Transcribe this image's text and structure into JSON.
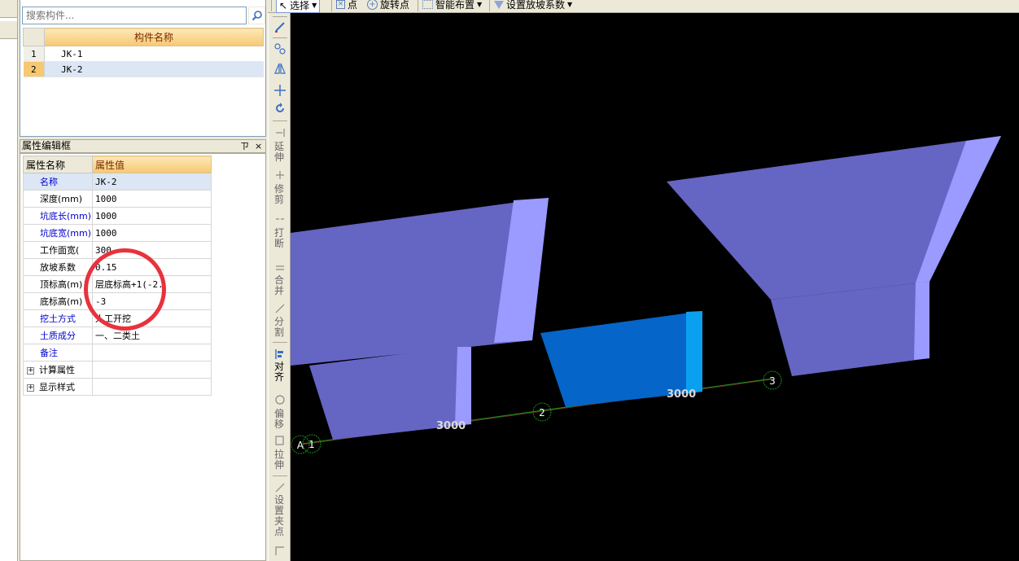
{
  "search": {
    "placeholder": "搜索构件..."
  },
  "component_list": {
    "header": "构件名称",
    "rows": [
      {
        "num": "1",
        "name": "JK-1"
      },
      {
        "num": "2",
        "name": "JK-2"
      }
    ]
  },
  "property_panel": {
    "title": "属性编辑框",
    "pin_label": "ㄗ",
    "close_label": "×",
    "col_name": "属性名称",
    "col_value": "属性值",
    "rows": [
      {
        "key": "名称",
        "value": "JK-2"
      },
      {
        "key": "深度(mm)",
        "value": "1000"
      },
      {
        "key": "坑底长(mm)",
        "value": "1000"
      },
      {
        "key": "坑底宽(mm)",
        "value": "1000"
      },
      {
        "key": "工作面宽(",
        "value": "300"
      },
      {
        "key": "放坡系数",
        "value": "0.15"
      },
      {
        "key": "顶标高(m)",
        "value": "层底标高+1(-2."
      },
      {
        "key": "底标高(m)",
        "value": "-3"
      },
      {
        "key": "挖土方式",
        "value": "人工开挖"
      },
      {
        "key": "土质成分",
        "value": "一、二类土"
      },
      {
        "key": "备注",
        "value": ""
      }
    ],
    "groups": [
      "计算属性",
      "显示样式"
    ]
  },
  "top_toolbar": {
    "select": "选择",
    "point": "点",
    "rotate_point": "旋转点",
    "smart_layout": "智能布置",
    "set_slope": "设置放坡系数"
  },
  "vertical_toolbar": {
    "extend": "延伸",
    "trim": "修剪",
    "break": "打断",
    "merge": "合并",
    "split": "分割",
    "align": "对齐",
    "offset": "偏移",
    "stretch": "拉伸",
    "set_grip": "设置夹点"
  },
  "canvas": {
    "axis_labels": [
      "A",
      "1",
      "2",
      "3"
    ],
    "dimensions": [
      "3000",
      "3000"
    ],
    "colors": {
      "pit_face": "#6565c4",
      "pit_side": "#9a9aff",
      "pit_selected": "#0565c8",
      "pit_selected_side": "#0aa0f0",
      "grid_line": "#1e8c1e",
      "background": "#000000"
    }
  }
}
